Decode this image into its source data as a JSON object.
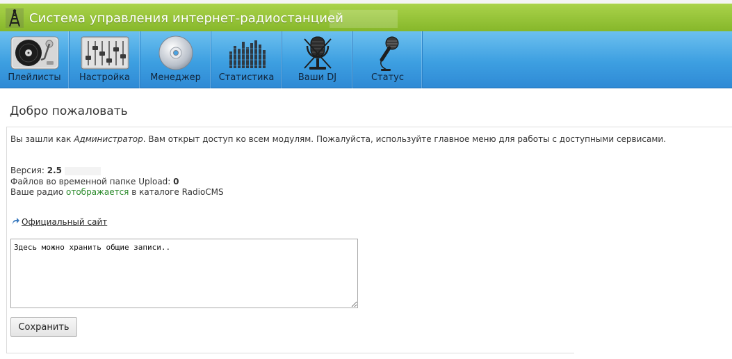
{
  "header": {
    "title": "Система управления интернет-радиостанцией"
  },
  "nav": {
    "items": [
      {
        "label": "Плейлисты",
        "icon": "turntable-icon"
      },
      {
        "label": "Настройка",
        "icon": "mixer-sliders-icon"
      },
      {
        "label": "Менеджер",
        "icon": "cd-disc-icon"
      },
      {
        "label": "Статистика",
        "icon": "equalizer-bars-icon"
      },
      {
        "label": "Ваши DJ",
        "icon": "studio-mic-icon"
      },
      {
        "label": "Статус",
        "icon": "microphone-icon"
      }
    ]
  },
  "main": {
    "welcome_title": "Добро пожаловать",
    "intro_prefix": "Вы зашли как ",
    "intro_role": "Администратор",
    "intro_suffix": ". Вам открыт доступ ко всем модулям. Пожалуйста, используйте главное меню для работы с доступными сервисами.",
    "version_label": "Версия: ",
    "version_value": "2.5",
    "upload_label": "Файлов во временной папке Upload: ",
    "upload_value": "0",
    "catalog_prefix": "Ваше радио ",
    "catalog_status": "отображается",
    "catalog_suffix": " в каталоге RadioCMS",
    "official_site_link": "Официальный сайт",
    "notes_value": "Здесь можно хранить общие записи..",
    "save_label": "Сохранить"
  },
  "colors": {
    "header_green": "#86b72a",
    "nav_blue": "#3d9fe1",
    "status_green": "#2a8a2a"
  }
}
